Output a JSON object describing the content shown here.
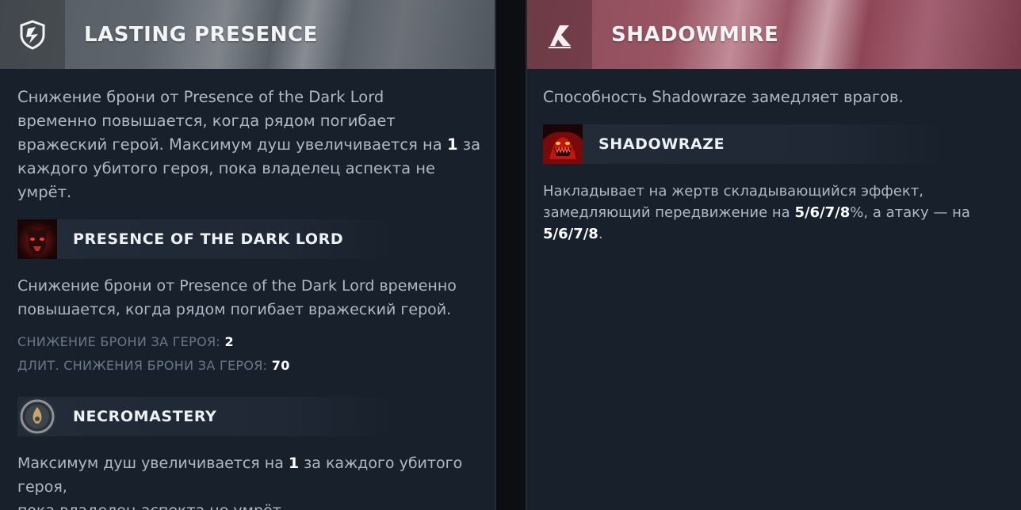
{
  "left": {
    "title": "LASTING PRESENCE",
    "header_icon": "shield-shard-icon",
    "description": {
      "line1": "Снижение брони от Presence of the Dark Lord",
      "line2": "временно повышается, когда рядом погибает",
      "line3_pre": "вражеский герой. Максимум душ увеличивается на ",
      "line3_num": "1",
      "line3_post": " за",
      "line4": "каждого убитого героя, пока владелец аспекта не",
      "line5": "умрёт."
    },
    "ability1": {
      "name": "PRESENCE OF THE DARK LORD",
      "icon": "dark-lord-icon",
      "desc_line1": "Снижение брони от Presence of the Dark Lord временно",
      "desc_line2": "повышается, когда рядом погибает вражеский герой.",
      "stat1_label": "СНИЖЕНИЕ БРОНИ ЗА ГЕРОЯ: ",
      "stat1_value": "2",
      "stat2_label": "ДЛИТ. СНИЖЕНИЯ БРОНИ ЗА ГЕРОЯ: ",
      "stat2_value": "70"
    },
    "ability2": {
      "name": "NECROMASTERY",
      "icon": "necromastery-icon",
      "desc_line1_pre": "Максимум душ увеличивается на ",
      "desc_line1_num": "1",
      "desc_line1_post": " за каждого убитого героя,",
      "desc_line2": "пока владелец аспекта не умрёт."
    }
  },
  "right": {
    "title": "SHADOWMIRE",
    "header_icon": "shadowmire-icon",
    "description": "Способность Shadowraze замедляет врагов.",
    "ability1": {
      "name": "SHADOWRAZE",
      "icon": "shadowraze-icon",
      "desc_line1": "Накладывает на жертв складывающийся эффект,",
      "desc_line2_pre": "замедляющий передвижение на ",
      "desc_line2_val": "5/6/7/8",
      "desc_line2_post": "%, а атаку — на",
      "desc_line3_val": "5/6/7/8",
      "desc_line3_post": "."
    }
  },
  "colors": {
    "panel_bg": "#18202b",
    "left_header": "#5f656c",
    "right_header": "#9a5464",
    "text": "#aeb9c4",
    "highlight": "#ffffff",
    "stat_label": "#6b7785"
  }
}
